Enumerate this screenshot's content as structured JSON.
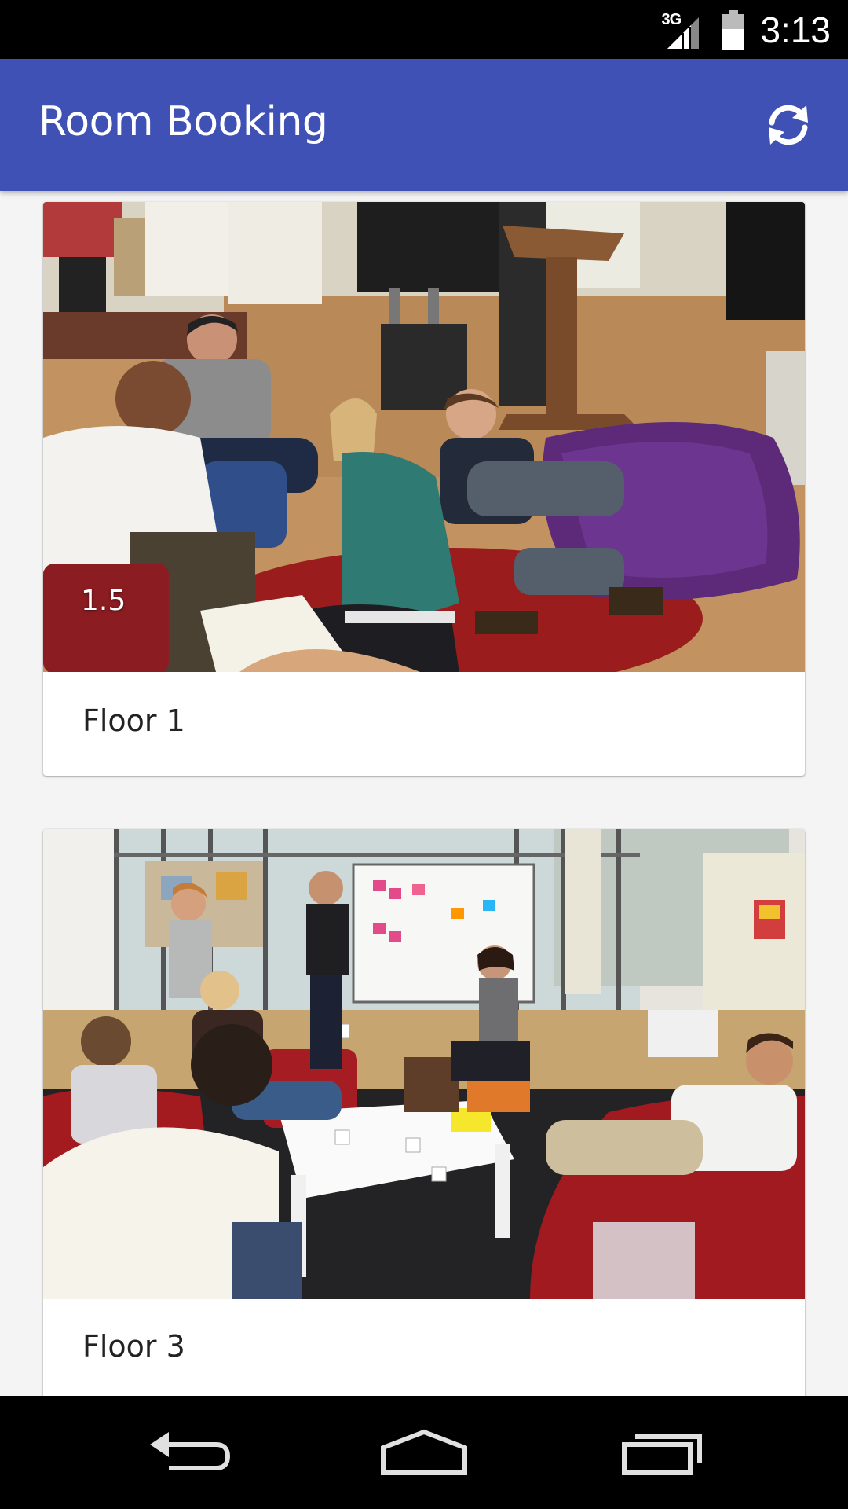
{
  "status_bar": {
    "network_type": "3G",
    "time": "3:13",
    "icons": [
      "signal-icon",
      "battery-icon"
    ]
  },
  "app_bar": {
    "title": "Room Booking",
    "refresh_icon": "refresh-icon"
  },
  "cards": [
    {
      "image_caption": "1.5",
      "label": "Floor 1",
      "image_desc": "photo-people-meeting-beanbag"
    },
    {
      "image_caption": "",
      "label": "Floor 3",
      "image_desc": "photo-people-lounge-whiteboard"
    }
  ],
  "nav_bar": {
    "icons": [
      "back-icon",
      "home-icon",
      "recents-icon"
    ]
  },
  "colors": {
    "app_bar": "#3f51b5",
    "background": "#f4f4f4",
    "status_bar": "#000000",
    "nav_bar": "#000000"
  }
}
